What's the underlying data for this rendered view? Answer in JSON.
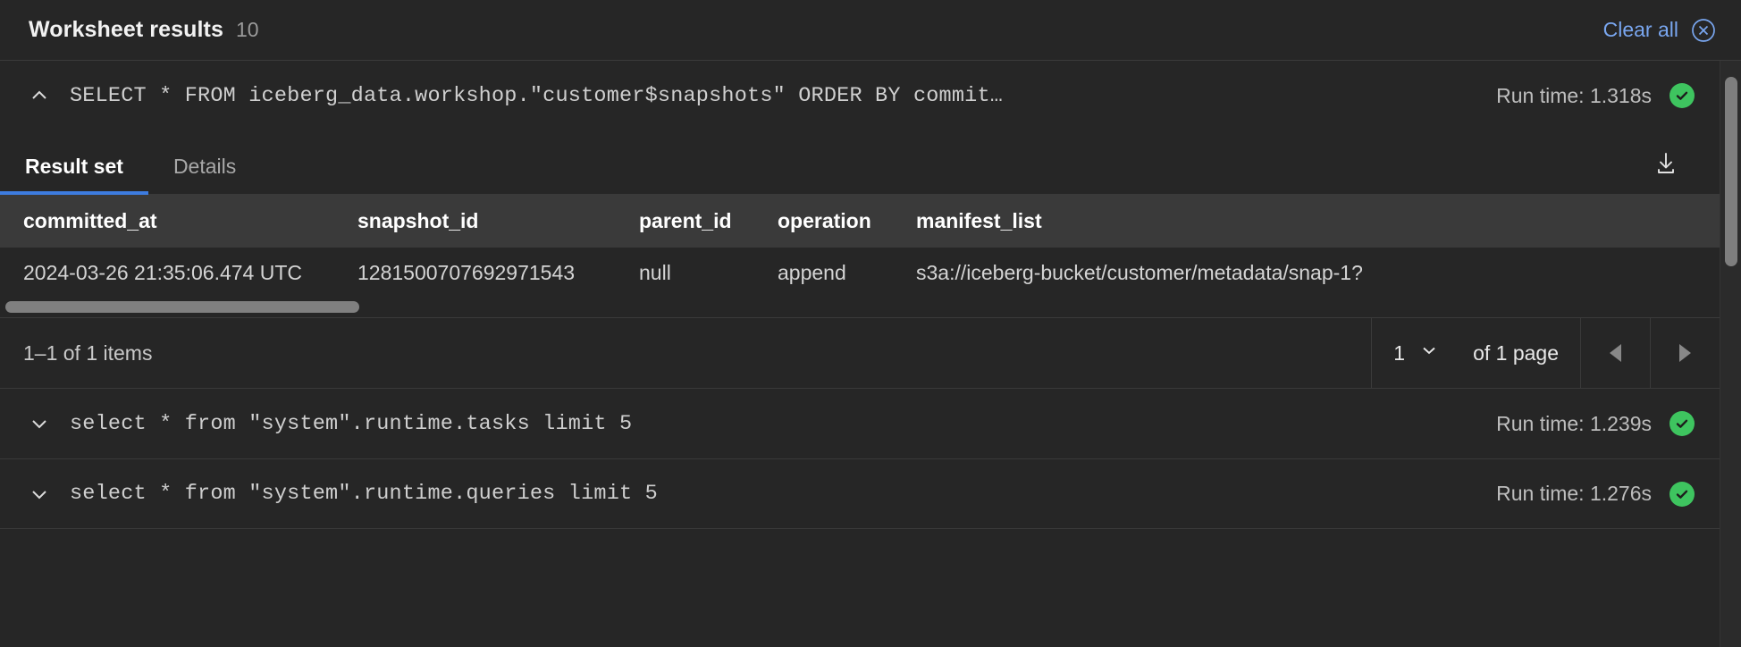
{
  "header": {
    "title": "Worksheet results",
    "count": "10",
    "clear_all_label": "Clear all",
    "clear_all_icon": "close-circle-icon"
  },
  "expanded_query": {
    "chevron_icon": "chevron-up-icon",
    "sql": "SELECT * FROM iceberg_data.workshop.\"customer$snapshots\" ORDER BY commit…",
    "runtime": "Run time: 1.318s",
    "status_icon": "check-circle-icon",
    "status_color": "#3ec45f"
  },
  "tabs": {
    "items": [
      {
        "label": "Result set",
        "active": true
      },
      {
        "label": "Details",
        "active": false
      }
    ],
    "active_underline_color": "#3d7ce0",
    "download_icon": "download-icon"
  },
  "result_table": {
    "columns": [
      "committed_at",
      "snapshot_id",
      "parent_id",
      "operation",
      "manifest_list"
    ],
    "rows": [
      [
        "2024-03-26 21:35:06.474 UTC",
        "1281500707692971543",
        "null",
        "append",
        "s3a://iceberg-bucket/customer/metadata/snap-1?"
      ]
    ]
  },
  "pagination": {
    "items_label": "1–1 of 1 items",
    "page_value": "1",
    "page_dropdown_icon": "chevron-down-icon",
    "of_pages_label": "of 1 page",
    "prev_icon": "triangle-left-icon",
    "next_icon": "triangle-right-icon"
  },
  "collapsed_queries": [
    {
      "chevron_icon": "chevron-down-icon",
      "sql": "select * from \"system\".runtime.tasks limit 5",
      "runtime": "Run time: 1.239s",
      "status_icon": "check-circle-icon"
    },
    {
      "chevron_icon": "chevron-down-icon",
      "sql": "select * from \"system\".runtime.queries limit 5",
      "runtime": "Run time: 1.276s",
      "status_icon": "check-circle-icon"
    }
  ]
}
